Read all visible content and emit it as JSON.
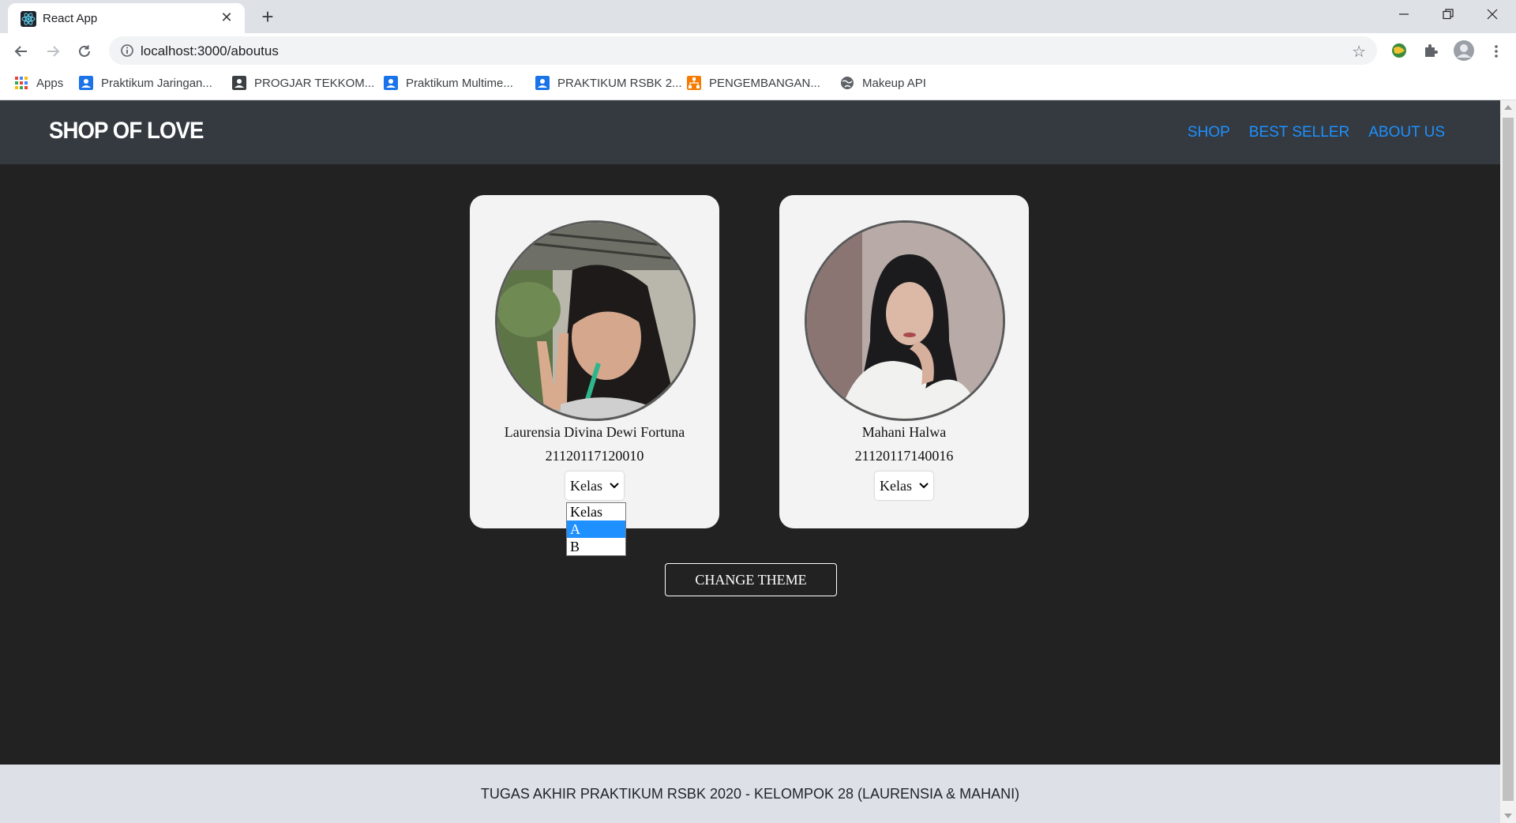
{
  "browser": {
    "tab_title": "React App",
    "url": "localhost:3000/aboutus",
    "bookmarks": [
      {
        "label": "Apps",
        "icon": "apps-grid-icon"
      },
      {
        "label": "Praktikum Jaringan...",
        "icon": "classroom-icon"
      },
      {
        "label": "PROGJAR TEKKOM...",
        "icon": "classroom-icon"
      },
      {
        "label": "Praktikum Multime...",
        "icon": "classroom-icon"
      },
      {
        "label": "PRAKTIKUM RSBK 2...",
        "icon": "classroom-icon"
      },
      {
        "label": "PENGEMBANGAN...",
        "icon": "orange-org-icon"
      },
      {
        "label": "Makeup API",
        "icon": "globe-icon"
      }
    ]
  },
  "navbar": {
    "brand": "SHOP OF LOVE",
    "links": [
      "SHOP",
      "BEST SELLER",
      "ABOUT US"
    ],
    "link_color": "#1e90ff"
  },
  "cards": [
    {
      "name": "Laurensia Divina Dewi Fortuna",
      "nim": "21120117120010",
      "select_value": "Kelas"
    },
    {
      "name": "Mahani Halwa",
      "nim": "21120117140016",
      "select_value": "Kelas"
    }
  ],
  "dropdown": {
    "options": [
      "Kelas",
      "A",
      "B"
    ],
    "highlighted": "A"
  },
  "theme_button": "CHANGE THEME",
  "footer": "TUGAS AKHIR PRAKTIKUM RSBK 2020 - KELOMPOK 28 (LAURENSIA & MAHANI)"
}
